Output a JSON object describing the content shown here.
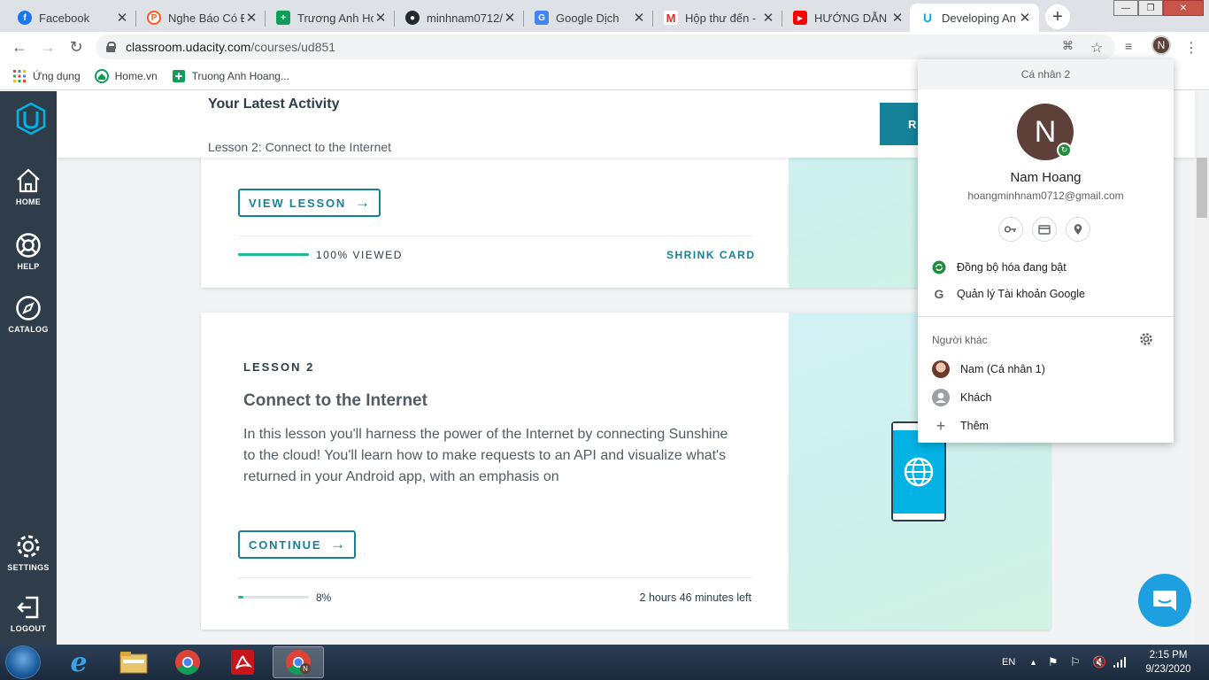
{
  "browser": {
    "tabs": [
      {
        "title": "Facebook",
        "icon": "facebook-icon",
        "color": "#1877f2",
        "glyph": "f"
      },
      {
        "title": "Nghe Báo Có Đ",
        "icon": "podcast-icon",
        "color": "#ff5722",
        "glyph": "P"
      },
      {
        "title": "Trương Anh Ho",
        "icon": "sheets-icon",
        "color": "#0f9d58",
        "glyph": "+"
      },
      {
        "title": "minhnam0712/",
        "icon": "github-icon",
        "color": "#24292e",
        "glyph": "●"
      },
      {
        "title": "Google Dịch",
        "icon": "translate-icon",
        "color": "#4285f4",
        "glyph": "G"
      },
      {
        "title": "Hộp thư đến - ",
        "icon": "gmail-icon",
        "color": "#ffffff",
        "glyph": "M"
      },
      {
        "title": "HƯỚNG DẪN T",
        "icon": "youtube-icon",
        "color": "#ff0000",
        "glyph": "▶"
      },
      {
        "title": "Developing An",
        "icon": "udacity-icon",
        "color": "#ffffff",
        "glyph": "U"
      }
    ],
    "url_domain": "classroom.udacity.com",
    "url_path": "/courses/ud851",
    "profile_initial": "N",
    "bookmarks": [
      {
        "label": "Ứng dụng",
        "icon": "apps-grid-icon"
      },
      {
        "label": "Home.vn",
        "icon": "home-vn-icon"
      },
      {
        "label": "Truong Anh Hoang...",
        "icon": "sheets-icon"
      }
    ]
  },
  "sidebar": {
    "items": [
      {
        "label": "HOME",
        "icon": "home-icon"
      },
      {
        "label": "HELP",
        "icon": "help-lifebuoy-icon"
      },
      {
        "label": "CATALOG",
        "icon": "compass-icon"
      },
      {
        "label": "SETTINGS",
        "icon": "gear-icon"
      },
      {
        "label": "LOGOUT",
        "icon": "logout-icon"
      }
    ]
  },
  "activity": {
    "title": "Your Latest Activity",
    "subtitle": "Lesson 2: Connect to the Internet",
    "resume_label": "R"
  },
  "card1": {
    "button_label": "VIEW LESSON",
    "progress_fraction": 1.0,
    "progress_label": "100% VIEWED",
    "shrink_label": "SHRINK CARD"
  },
  "card2": {
    "lesson_label": "LESSON 2",
    "title": "Connect to the Internet",
    "description": "In this lesson you'll harness the power of the Internet by connecting Sunshine to the cloud! You'll learn how to make requests to an API and visualize what's returned in your Android app, with an emphasis on",
    "button_label": "CONTINUE",
    "progress_fraction": 0.08,
    "progress_label": "8%",
    "time_left": "2 hours 46 minutes left"
  },
  "profile_menu": {
    "header": "Cá nhân 2",
    "avatar_initial": "N",
    "name": "Nam Hoang",
    "email": "hoangminhnam0712@gmail.com",
    "sync_label": "Đồng bộ hóa đang bật",
    "manage_label": "Quản lý Tài khoản Google",
    "others_label": "Người khác",
    "people": [
      {
        "label": "Nam (Cá nhân 1)",
        "icon": "person-photo-icon"
      },
      {
        "label": "Khách",
        "icon": "guest-person-icon"
      },
      {
        "label": "Thêm",
        "icon": "plus-icon"
      }
    ]
  },
  "taskbar": {
    "language": "EN",
    "time": "2:15 PM",
    "date": "9/23/2020"
  },
  "colors": {
    "accent": "#15829a",
    "sidebar": "#2e3d49",
    "progress": "#1fb88f",
    "sync_green": "#1e8e3e"
  }
}
